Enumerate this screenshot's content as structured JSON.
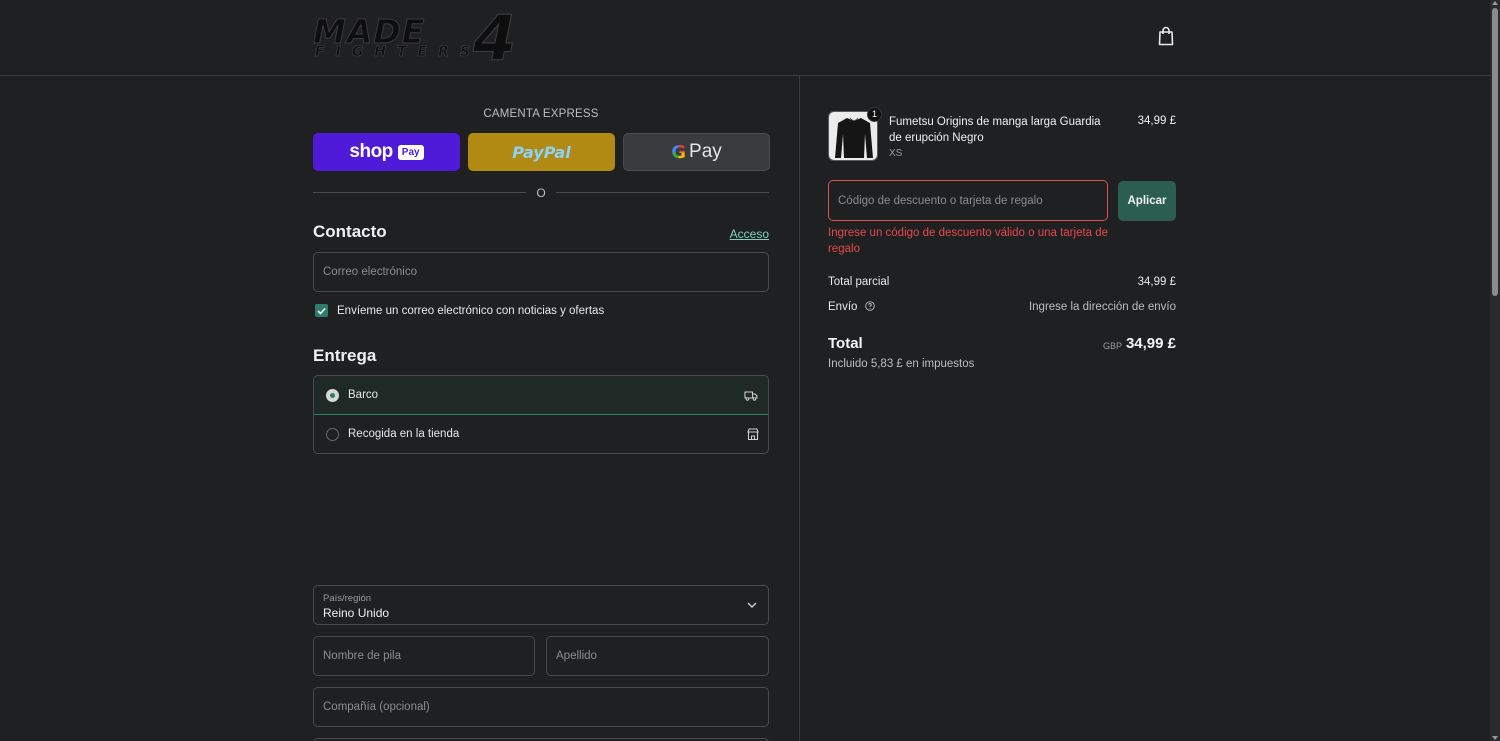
{
  "header": {
    "logo_main": "MADE",
    "logo_sub": "FIGHTERS",
    "logo_number": "4",
    "cart_icon": "shopping-bag-icon"
  },
  "express": {
    "title": "CAMENTA EXPRESS",
    "shop_label": "shop",
    "shop_pay_badge": "Pay",
    "paypal_label": "PayPal",
    "gpay_g": "G",
    "gpay_label": "Pay",
    "or_text": "O",
    "colors": {
      "shop": "#4f1ad8",
      "paypal": "#b08a12",
      "gpay": "#3a3b3e"
    }
  },
  "contact": {
    "title": "Contacto",
    "login_link": "Acceso",
    "email_placeholder": "Correo electrónico",
    "newsletter_label": "Envíeme un correo electrónico con noticias y ofertas",
    "newsletter_checked": true
  },
  "delivery": {
    "title": "Entrega",
    "options": [
      {
        "label": "Barco",
        "selected": true,
        "icon": "truck-icon"
      },
      {
        "label": "Recogida en la tienda",
        "selected": false,
        "icon": "store-icon"
      }
    ],
    "country_label": "País/región",
    "country_value": "Reino Unido",
    "first_name_placeholder": "Nombre de pila",
    "last_name_placeholder": "Apellido",
    "company_placeholder": "Compañía (opcional)"
  },
  "summary": {
    "product": {
      "name": "Fumetsu Origins de manga larga Guardia de erupción Negro",
      "variant": "XS",
      "price": "34,99 £",
      "quantity": "1"
    },
    "discount_placeholder": "Código de descuento o tarjeta de regalo",
    "apply_label": "Aplicar",
    "discount_error": "Ingrese un código de descuento válido o una tarjeta de regalo",
    "subtotal_label": "Total parcial",
    "subtotal_value": "34,99 £",
    "shipping_label": "Envío",
    "shipping_value": "Ingrese la dirección de envío",
    "total_label": "Total",
    "total_currency": "GBP",
    "total_value": "34,99 £",
    "tax_note": "Incluido 5,83 £ en impuestos",
    "colors": {
      "accent": "#2e7d68",
      "error": "#e5484d"
    }
  }
}
